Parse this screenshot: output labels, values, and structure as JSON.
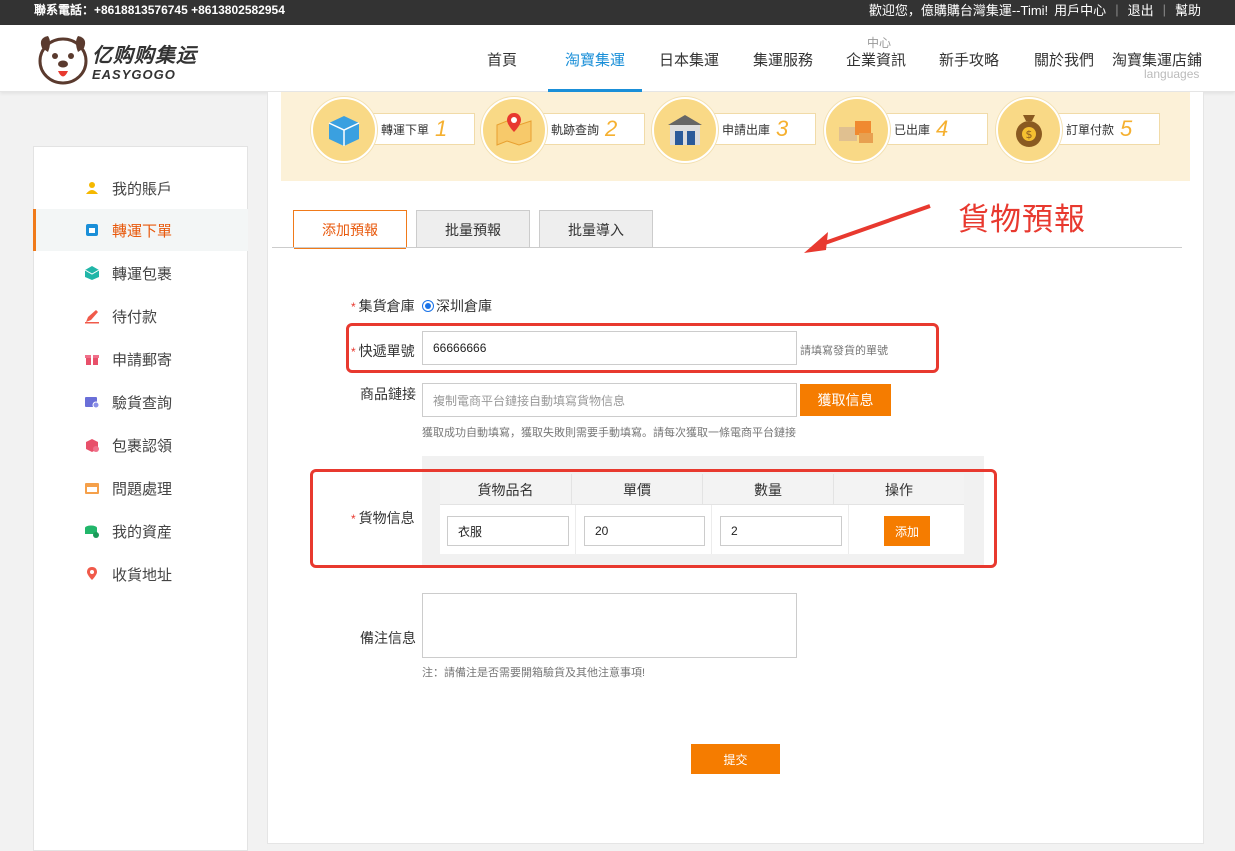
{
  "topbar": {
    "phone": "聯系電話：+8618813576745 +8613802582954",
    "welcome": "歡迎您，億購購台灣集運--Timi!",
    "user_center": "用戶中心",
    "logout": "退出",
    "help": "幫助"
  },
  "logo": {
    "cn": "亿购购集运",
    "en": "EASYGOGO"
  },
  "nav": {
    "items": [
      "首頁",
      "淘寶集運",
      "日本集運",
      "集運服務",
      "企業資訊",
      "新手攻略",
      "關於我們",
      "淘寶集運店鋪"
    ],
    "sup": "中心",
    "lang": "languages"
  },
  "sidebar": {
    "items": [
      "我的賬戶",
      "轉運下單",
      "轉運包裹",
      "待付款",
      "申請郵寄",
      "驗貨查詢",
      "包裹認領",
      "問題處理",
      "我的資産",
      "收貨地址"
    ]
  },
  "steps": [
    {
      "label": "轉運下單",
      "num": "1"
    },
    {
      "label": "軌跡查詢",
      "num": "2"
    },
    {
      "label": "申請出庫",
      "num": "3"
    },
    {
      "label": "已出庫",
      "num": "4"
    },
    {
      "label": "訂單付款",
      "num": "5"
    }
  ],
  "tabs": [
    "添加預報",
    "批量預報",
    "批量導入"
  ],
  "annotation": "貨物預報",
  "form": {
    "warehouse_label": "集貨倉庫",
    "warehouse_value": "深圳倉庫",
    "tracking_label": "快遞單號",
    "tracking_value": "66666666",
    "tracking_hint": "請填寫發貨的單號",
    "link_label": "商品鏈接",
    "link_placeholder": "複制電商平台鏈接自動填寫貨物信息",
    "fetch_button": "獲取信息",
    "link_hint": "獲取成功自動填寫，獲取失敗則需要手動填寫。請每次獲取一條電商平台鏈接",
    "goods_label": "貨物信息",
    "goods_headers": [
      "貨物品名",
      "單價",
      "數量",
      "操作"
    ],
    "goods_row": {
      "name": "衣服",
      "price": "20",
      "qty": "2"
    },
    "add_button": "添加",
    "remark_label": "備注信息",
    "remark_hint": "注：請備注是否需要開箱驗貨及其他注意事項!",
    "submit_button": "提交"
  },
  "colors": {
    "accent": "#f57c00",
    "nav_active": "#1a8fd8",
    "annotation": "#e8392f"
  }
}
